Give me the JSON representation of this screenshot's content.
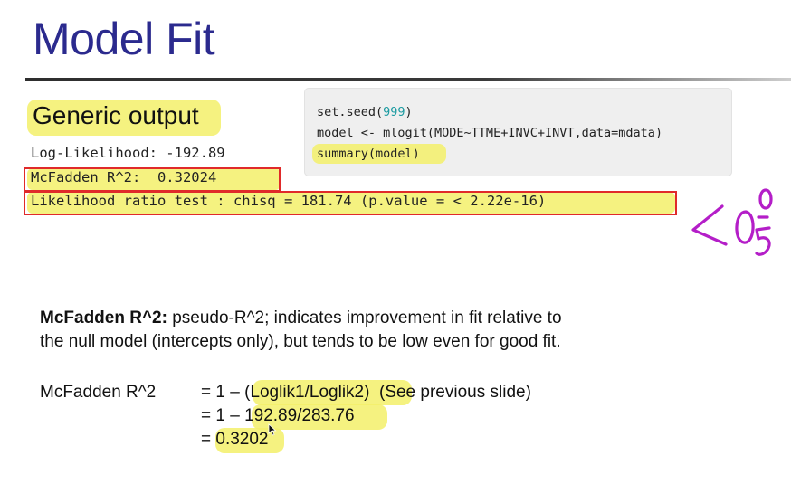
{
  "slide": {
    "title": "Model Fit",
    "section_heading": "Generic output",
    "output": {
      "loglik": "Log-Likelihood: -192.89",
      "mcfadden": "McFadden R^2:  0.32024",
      "lr_test": "Likelihood ratio test : chisq = 181.74 (p.value = < 2.22e-16)"
    },
    "code": {
      "line1_pre": "set.seed(",
      "line1_num": "999",
      "line1_post": ")",
      "line2": "model <- mlogit(MODE~TTME+INVC+INVT,data=mdata)",
      "line3": "summary(model)"
    },
    "explanation": {
      "term": "McFadden R^2:",
      "line1_rest": " pseudo-R^2; indicates improvement in fit relative to",
      "line2": "the null model (intercepts only), but tends to be low even for good fit."
    },
    "formula": {
      "label": "McFadden R^2",
      "line1_prefix": "= 1 – ",
      "line1_hl": "(Loglik1/Loglik2)",
      "line1_note": "  (See previous slide)",
      "line2_prefix": "= 1 – ",
      "line2_hl": "192.89/283.76",
      "line3_prefix": "= ",
      "line3_hl": "0.3202"
    },
    "annotation": {
      "handwritten": "<0.05",
      "ink_color": "#b41ec8"
    },
    "colors": {
      "title": "#2b2a8e",
      "highlight": "#f3f06a",
      "box": "#e02a2a",
      "code_number": "#1a9aa0"
    }
  }
}
